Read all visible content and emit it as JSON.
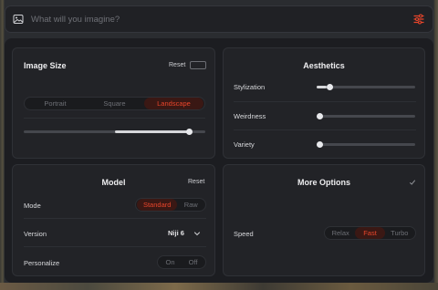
{
  "prompt": {
    "placeholder": "What will you imagine?"
  },
  "image_size": {
    "title": "Image Size",
    "reset_label": "Reset",
    "orientation_options": [
      "Portrait",
      "Square",
      "Landscape"
    ],
    "selected": "Landscape",
    "aspect_slider_value": 0.91
  },
  "aesthetics": {
    "title": "Aesthetics",
    "sliders": [
      {
        "label": "Stylization",
        "value": 0.1
      },
      {
        "label": "Weirdness",
        "value": 0.0
      },
      {
        "label": "Variety",
        "value": 0.0
      }
    ]
  },
  "model": {
    "title": "Model",
    "reset_label": "Reset",
    "mode_label": "Mode",
    "mode_options": [
      "Standard",
      "Raw"
    ],
    "mode_selected": "Standard",
    "version_label": "Version",
    "version_value": "Niji 6",
    "personalize_label": "Personalize",
    "personalize_options": [
      "On",
      "Off"
    ]
  },
  "more_options": {
    "title": "More Options",
    "speed_label": "Speed",
    "speed_options": [
      "Relax",
      "Fast",
      "Turbo"
    ],
    "speed_selected": "Fast"
  },
  "colors": {
    "accent": "#e8452b",
    "panel": "#1c1d21",
    "card": "#222327"
  }
}
